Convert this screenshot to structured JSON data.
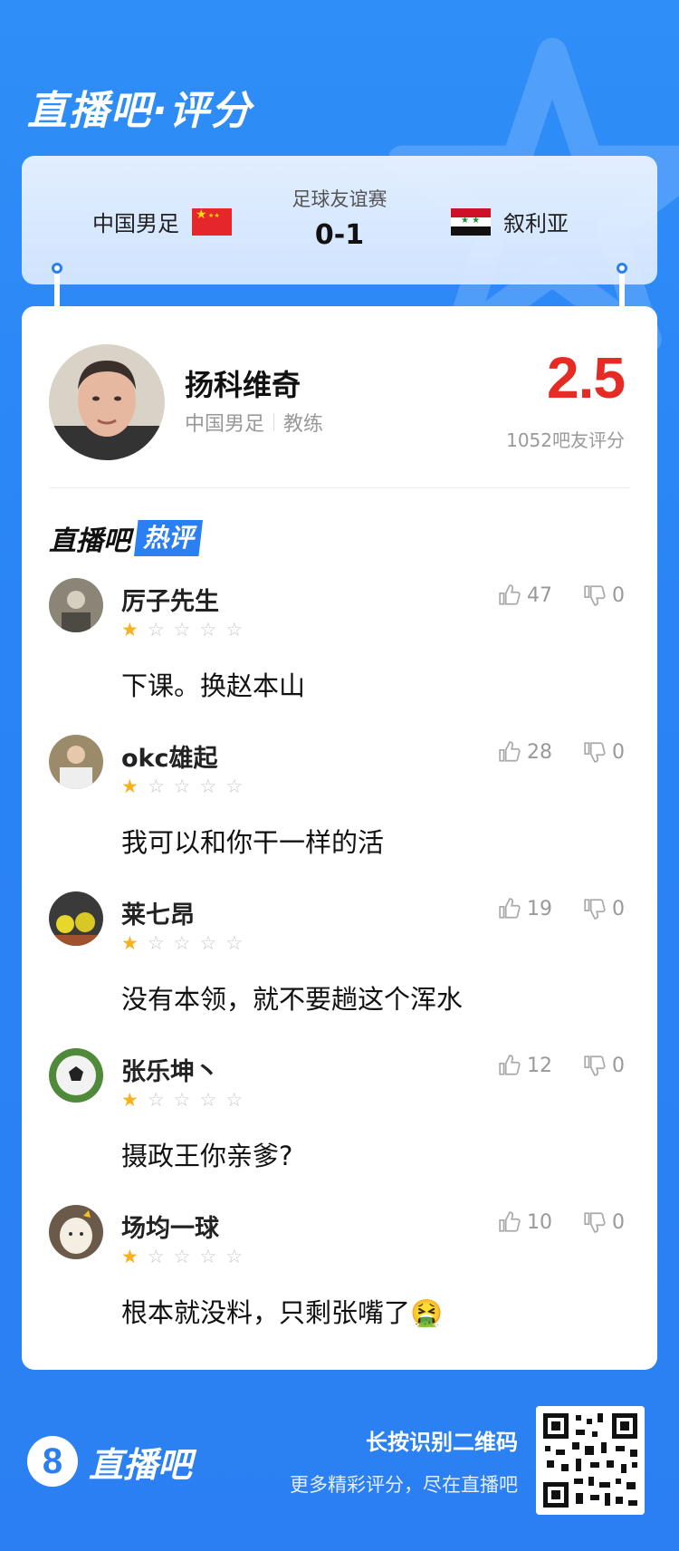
{
  "header": {
    "title": "直播吧·评分"
  },
  "match": {
    "type": "足球友谊赛",
    "score": "0-1",
    "home_team": "中国男足",
    "away_team": "叙利亚"
  },
  "coach": {
    "name": "扬科维奇",
    "team": "中国男足",
    "role": "教练",
    "rating": "2.5",
    "rating_count": "1052吧友评分"
  },
  "hot_comments": {
    "brand": "直播吧",
    "tag": "热评",
    "items": [
      {
        "user": "厉子先生",
        "stars": 1,
        "text": "下课。换赵本山",
        "likes": "47",
        "dislikes": "0"
      },
      {
        "user": "okc雄起",
        "stars": 1,
        "text": "我可以和你干一样的活",
        "likes": "28",
        "dislikes": "0"
      },
      {
        "user": "莱七昂",
        "stars": 1,
        "text": "没有本领，就不要趟这个浑水",
        "likes": "19",
        "dislikes": "0"
      },
      {
        "user": "张乐坤丶",
        "stars": 1,
        "text": "摄政王你亲爹?",
        "likes": "12",
        "dislikes": "0"
      },
      {
        "user": "场均一球",
        "stars": 1,
        "text": "根本就没料，只剩张嘴了🤮",
        "likes": "10",
        "dislikes": "0"
      }
    ]
  },
  "footer": {
    "logo_digit": "8",
    "logo_text": "直播吧",
    "hint_main": "长按识别二维码",
    "hint_sub": "更多精彩评分，尽在直播吧"
  },
  "colors": {
    "brand_blue": "#2b7ff2",
    "rating_red": "#e52b23",
    "star_gold": "#f6b21b"
  }
}
